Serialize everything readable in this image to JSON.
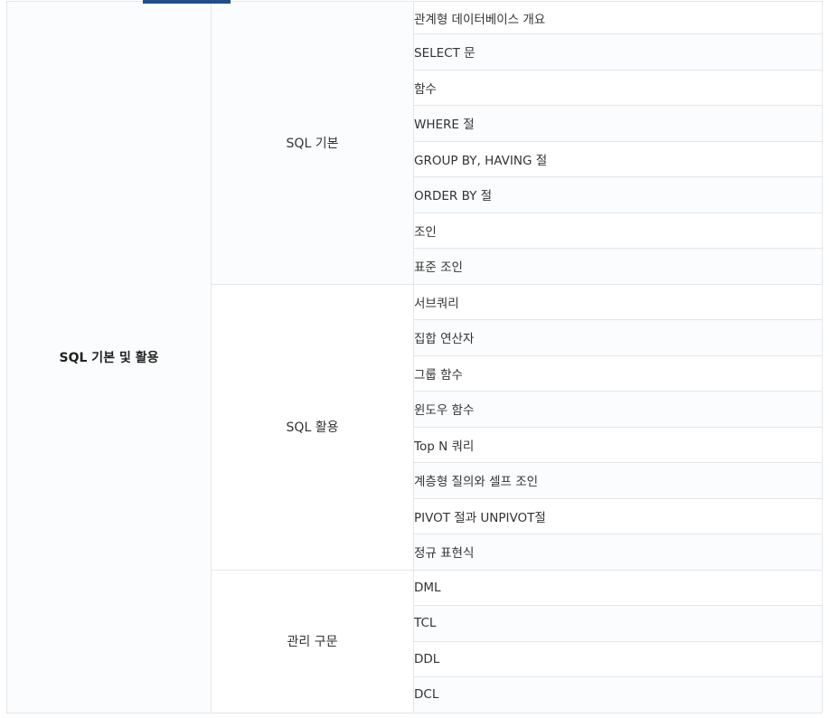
{
  "section": {
    "title": "SQL 기본 및 활용",
    "groups": [
      {
        "name": "SQL 기본",
        "items": [
          "관계형 데이터베이스 개요",
          "SELECT 문",
          "함수",
          "WHERE 절",
          "GROUP BY, HAVING 절",
          "ORDER BY 절",
          "조인",
          "표준 조인"
        ]
      },
      {
        "name": "SQL 활용",
        "items": [
          "서브쿼리",
          "집합 연산자",
          "그룹 함수",
          "윈도우 함수",
          "Top N 쿼리",
          "계층형 질의와 셀프 조인",
          "PIVOT 절과 UNPIVOT절",
          "정규 표현식"
        ]
      },
      {
        "name": "관리 구문",
        "items": [
          "DML",
          "TCL",
          "DDL",
          "DCL"
        ]
      }
    ]
  },
  "colors": {
    "accent": "#1f4e8c",
    "border": "#e3e6ea",
    "shade": "#fbfcfd"
  }
}
